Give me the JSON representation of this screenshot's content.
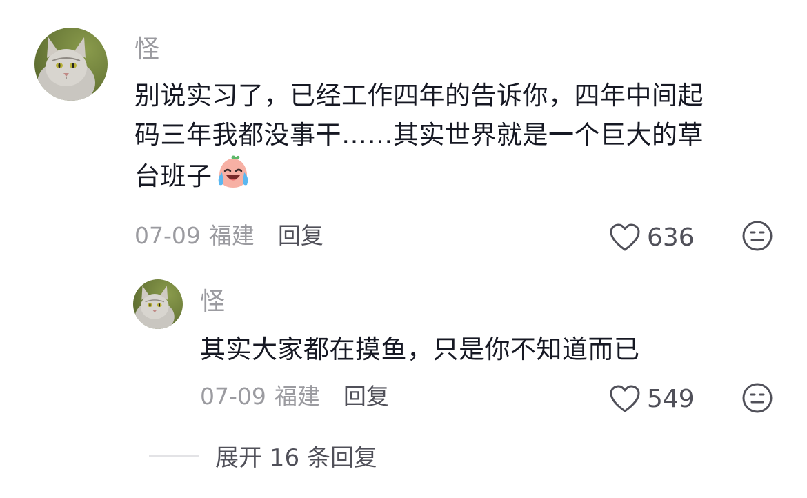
{
  "comments": [
    {
      "author": "怪",
      "lines": [
        "别说实习了，已经工作四年的告诉你，四年中间起",
        "码三年我都没事干……其实世界就是一个巨大的草",
        "台班子"
      ],
      "emoji": "crying-laughing-face-emoji",
      "date": "07-09",
      "location": "福建",
      "reply_label": "回复",
      "likes": "636"
    },
    {
      "author": "怪",
      "lines": [
        "其实大家都在摸鱼，只是你不知道而已"
      ],
      "date": "07-09",
      "location": "福建",
      "reply_label": "回复",
      "likes": "549"
    }
  ],
  "expand_label": "展开 16 条回复",
  "icons": {
    "like": "heart-outline-icon",
    "dislike": "neutral-face-icon"
  },
  "colors": {
    "text": "#161823",
    "secondary": "#9b9ba0",
    "action": "#505059"
  }
}
